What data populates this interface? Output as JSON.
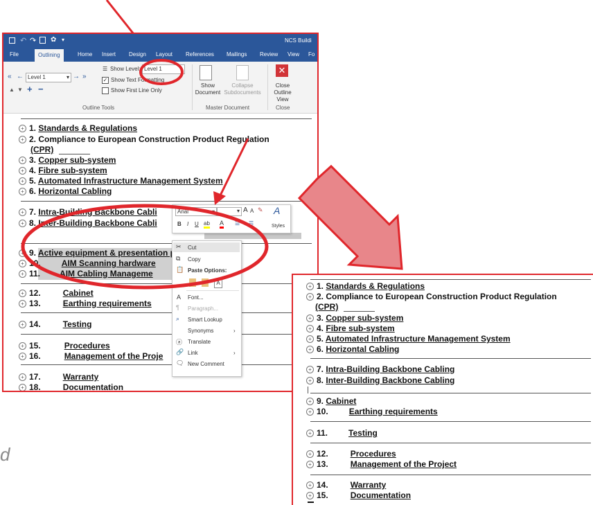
{
  "word": {
    "title": "NCS Buildi",
    "tabs": [
      "File",
      "Outlining",
      "Home",
      "Insert",
      "Design",
      "Layout",
      "References",
      "Mailings",
      "Review",
      "View",
      "Fo"
    ],
    "ribbon": {
      "level_value": "Level 1",
      "show_level_label": "Show Level:",
      "show_level_value": "Level 1",
      "show_text_formatting": "Show Text Formatting",
      "show_first_line_only": "Show First Line Only",
      "outline_tools_label": "Outline Tools",
      "show_document": "Show Document",
      "collapse_subdocuments": "Collapse Subdocuments",
      "master_document_label": "Master Document",
      "close_outline_view": "Close Outline View",
      "close_label": "Close"
    }
  },
  "left_outline": [
    {
      "num": "1.",
      "text": "Standards & Regulations"
    },
    {
      "num": "2.",
      "text": "Compliance to European Construction Product Regulation"
    },
    {
      "num": "",
      "text": "(CPR)"
    },
    {
      "num": "3.",
      "text": "Copper sub-system"
    },
    {
      "num": "4.",
      "text": "Fibre sub-system"
    },
    {
      "num": "5.",
      "text": "Automated Infrastructure Management System"
    },
    {
      "num": "6.",
      "text": "Horizontal Cabling"
    },
    {
      "num": "7.",
      "text": "Intra-Building Backbone Cabli"
    },
    {
      "num": "8.",
      "text": "Inter-Building Backbone Cabli"
    },
    {
      "num": "9.",
      "text": "Active equipment & presentation panels"
    },
    {
      "num": "10.",
      "text": "AIM Scanning hardware"
    },
    {
      "num": "11.",
      "text": "AIM Cabling Manageme"
    },
    {
      "num": "12.",
      "text": "Cabinet"
    },
    {
      "num": "13.",
      "text": "Earthing requirements"
    },
    {
      "num": "14.",
      "text": "Testing"
    },
    {
      "num": "15.",
      "text": "Procedures"
    },
    {
      "num": "16.",
      "text": "Management of the Proje"
    },
    {
      "num": "17.",
      "text": "Warranty"
    },
    {
      "num": "18.",
      "text": "Documentation"
    }
  ],
  "mini_toolbar": {
    "font": "Arial",
    "styles_label": "Styles"
  },
  "context_menu": {
    "cut": "Cut",
    "copy": "Copy",
    "paste_options": "Paste Options:",
    "font": "Font...",
    "paragraph": "Paragraph...",
    "smart_lookup": "Smart Lookup",
    "synonyms": "Synonyms",
    "translate": "Translate",
    "link": "Link",
    "new_comment": "New Comment"
  },
  "right_outline": [
    {
      "num": "1.",
      "text": "Standards & Regulations"
    },
    {
      "num": "2.",
      "text": "Compliance to European Construction Product Regulation"
    },
    {
      "num": "",
      "text": "(CPR)"
    },
    {
      "num": "3.",
      "text": "Copper sub-system"
    },
    {
      "num": "4.",
      "text": "Fibre sub-system"
    },
    {
      "num": "5.",
      "text": "Automated Infrastructure Management System"
    },
    {
      "num": "6.",
      "text": "Horizontal Cabling"
    },
    {
      "num": "7.",
      "text": "Intra-Building Backbone Cabling"
    },
    {
      "num": "8.",
      "text": "Inter-Building Backbone Cabling"
    },
    {
      "num": "9.",
      "text": "Cabinet"
    },
    {
      "num": "10.",
      "text": "Earthing requirements"
    },
    {
      "num": "11.",
      "text": "Testing"
    },
    {
      "num": "12.",
      "text": "Procedures"
    },
    {
      "num": "13.",
      "text": "Management of the Project"
    },
    {
      "num": "14.",
      "text": "Warranty"
    },
    {
      "num": "15.",
      "text": "Documentation"
    }
  ],
  "page_fragment": "d",
  "colors": {
    "accent": "#e0262b",
    "word_blue": "#2b579a",
    "arrow_fill": "#e8868a"
  }
}
